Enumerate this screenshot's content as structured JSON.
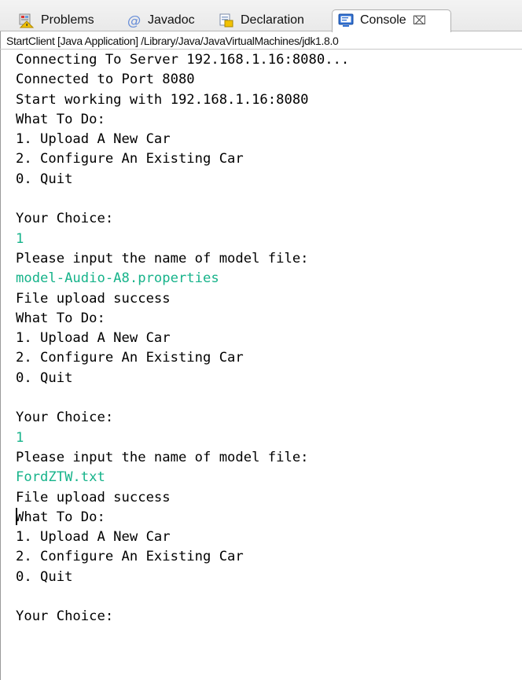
{
  "tabs": [
    {
      "label": "Problems",
      "icon": "problems-icon"
    },
    {
      "label": "Javadoc",
      "icon": "javadoc-at-icon"
    },
    {
      "label": "Declaration",
      "icon": "declaration-icon"
    },
    {
      "label": "Console",
      "icon": "console-icon",
      "active": true,
      "close": "⌧"
    }
  ],
  "launch": {
    "text": "StartClient [Java Application] /Library/Java/JavaVirtualMachines/jdk1.8.0"
  },
  "console": {
    "lines": [
      {
        "text": "Connecting To Server 192.168.1.16:8080...",
        "input": false
      },
      {
        "text": "Connected to Port 8080",
        "input": false
      },
      {
        "text": "Start working with 192.168.1.16:8080",
        "input": false
      },
      {
        "text": "What To Do:",
        "input": false
      },
      {
        "text": "1. Upload A New Car",
        "input": false
      },
      {
        "text": "2. Configure An Existing Car",
        "input": false
      },
      {
        "text": "0. Quit",
        "input": false
      },
      {
        "text": "",
        "input": false
      },
      {
        "text": "Your Choice:",
        "input": false
      },
      {
        "text": "1",
        "input": true
      },
      {
        "text": "Please input the name of model file:",
        "input": false
      },
      {
        "text": "model-Audio-A8.properties",
        "input": true
      },
      {
        "text": "File upload success",
        "input": false
      },
      {
        "text": "What To Do:",
        "input": false
      },
      {
        "text": "1. Upload A New Car",
        "input": false
      },
      {
        "text": "2. Configure An Existing Car",
        "input": false
      },
      {
        "text": "0. Quit",
        "input": false
      },
      {
        "text": "",
        "input": false
      },
      {
        "text": "Your Choice:",
        "input": false
      },
      {
        "text": "1",
        "input": true
      },
      {
        "text": "Please input the name of model file:",
        "input": false
      },
      {
        "text": "FordZTW.txt",
        "input": true
      },
      {
        "text": "File upload success",
        "input": false
      },
      {
        "text": "What To Do:",
        "input": false
      },
      {
        "text": "1. Upload A New Car",
        "input": false
      },
      {
        "text": "2. Configure An Existing Car",
        "input": false
      },
      {
        "text": "0. Quit",
        "input": false
      },
      {
        "text": "",
        "input": false
      },
      {
        "text": "Your Choice:",
        "input": false
      }
    ]
  },
  "colors": {
    "input_text": "#16b38a",
    "console_icon": "#2f6fd2"
  }
}
